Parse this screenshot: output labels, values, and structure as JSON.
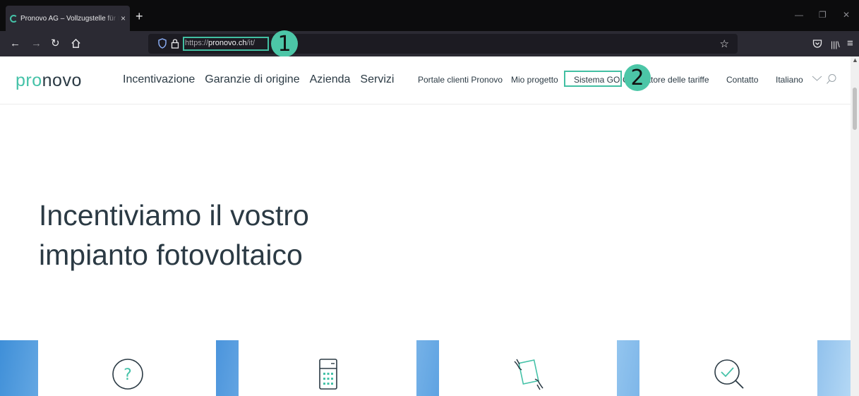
{
  "browser": {
    "tab_title": "Pronovo AG – Vollzugstelle für Herkunftsnachweise",
    "tab_close": "×",
    "new_tab": "+",
    "url_prefix": "https://",
    "url_host": "pronovo.ch",
    "url_path": "/it/",
    "marker_1": "1",
    "marker_2": "2"
  },
  "site": {
    "logo_accent": "pro",
    "logo_rest": "novo",
    "main_nav": [
      "Incentivazione",
      "Garanzie di origine",
      "Azienda",
      "Servizi"
    ],
    "sub_nav": {
      "portal": "Portale clienti Pronovo",
      "project": "Mio progetto",
      "go_system": "Sistema GO",
      "tariff_calc": "Calcolatore delle tariffe",
      "contact": "Contatto",
      "language": "Italiano"
    },
    "hero_line1": "Incentiviamo il vostro",
    "hero_line2": "impianto fotovoltaico"
  },
  "colors": {
    "accent": "#45c2a8",
    "text": "#2b3a44",
    "highlight": "#42bfa2"
  }
}
